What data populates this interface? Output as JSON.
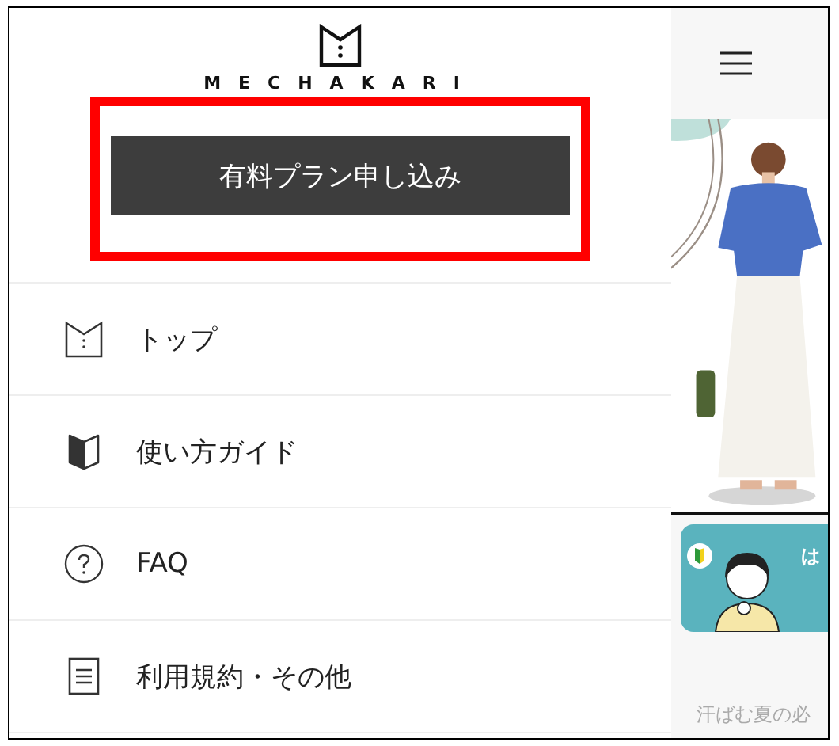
{
  "logo": {
    "text": "MECHAKARI"
  },
  "cta_button": {
    "label": "有料プラン申し込み"
  },
  "menu": [
    {
      "kind": "logo",
      "label": "トップ"
    },
    {
      "kind": "book",
      "label": "使い方ガイド"
    },
    {
      "kind": "help",
      "label": "FAQ"
    },
    {
      "kind": "document",
      "label": "利用規約・その他"
    }
  ],
  "background_page": {
    "banner": {
      "text": "は"
    },
    "caption": "汗ばむ夏の必"
  }
}
